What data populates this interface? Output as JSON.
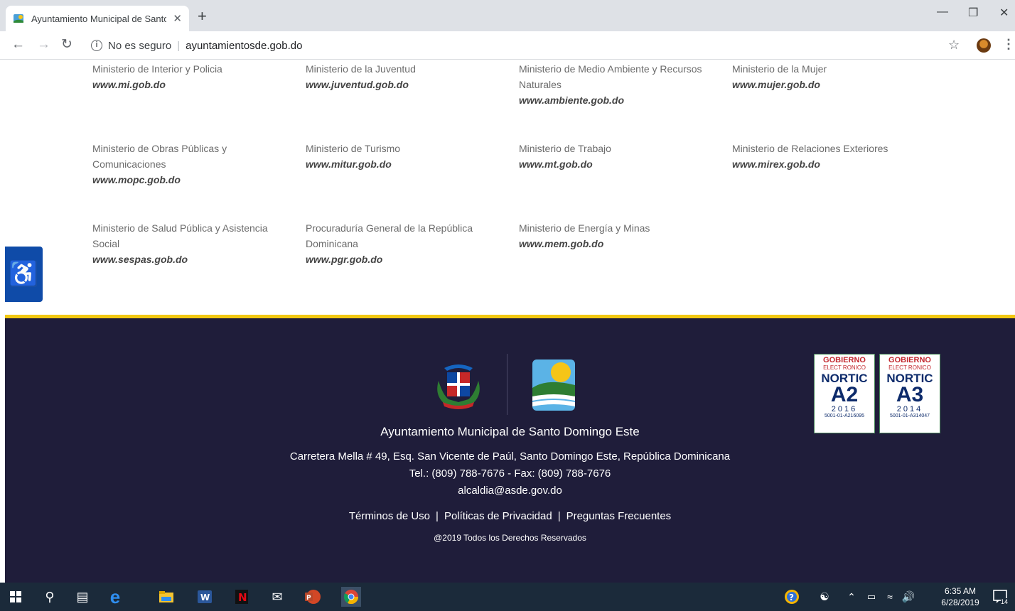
{
  "browser": {
    "tab_title": "Ayuntamiento Municipal de Santo Domingo Este",
    "tab_close": "✕",
    "new_tab": "+",
    "security_label": "No es seguro",
    "url": "ayuntamientosde.gob.do"
  },
  "ministries": [
    {
      "name": "Ministerio de Interior y Policia",
      "url": "www.mi.gob.do"
    },
    {
      "name": "Ministerio de la Juventud",
      "url": "www.juventud.gob.do"
    },
    {
      "name": "Ministerio de Medio Ambiente y Recursos Naturales",
      "url": "www.ambiente.gob.do"
    },
    {
      "name": "Ministerio de la Mujer",
      "url": "www.mujer.gob.do"
    },
    {
      "name": "Ministerio de Obras Públicas y Comunicaciones",
      "url": "www.mopc.gob.do"
    },
    {
      "name": "Ministerio de Turismo",
      "url": "www.mitur.gob.do"
    },
    {
      "name": "Ministerio de Trabajo",
      "url": "www.mt.gob.do"
    },
    {
      "name": "Ministerio de Relaciones Exteriores",
      "url": "www.mirex.gob.do"
    },
    {
      "name": "Ministerio de Salud Pública y Asistencia Social",
      "url": "www.sespas.gob.do"
    },
    {
      "name": "Procuraduría General de la República Dominicana",
      "url": "www.pgr.gob.do"
    },
    {
      "name": "Ministerio de Energía y Minas",
      "url": "www.mem.gob.do"
    }
  ],
  "footer": {
    "org_name": "Ayuntamiento Municipal de Santo Domingo Este",
    "address": "Carretera Mella # 49, Esq. San Vicente de Paúl, Santo Domingo Este, República Dominicana",
    "phone": "Tel.: (809) 788-7676 - Fax: (809) 788-7676",
    "email": "alcaldia@asde.gov.do",
    "links": [
      "Términos de Uso",
      "Políticas de Privacidad",
      "Preguntas Frecuentes"
    ],
    "copyright": "@2019 Todos los Derechos Reservados"
  },
  "badges": [
    {
      "top": "GOBIERNO",
      "sub": "ELECT RONICO",
      "name": "NORTIC",
      "level": "A2",
      "year": "2016",
      "code": "5001-01-A216095"
    },
    {
      "top": "GOBIERNO",
      "sub": "ELECT RONICO",
      "name": "NORTIC",
      "level": "A3",
      "year": "2014",
      "code": "5001-01-A314047"
    }
  ],
  "taskbar": {
    "time": "6:35 AM",
    "date": "6/28/2019",
    "notification_count": "14"
  },
  "colors": {
    "footer_bg": "#1f1d3a",
    "footer_accent": "#f2c811",
    "accessibility_button": "#0f4ba8"
  }
}
